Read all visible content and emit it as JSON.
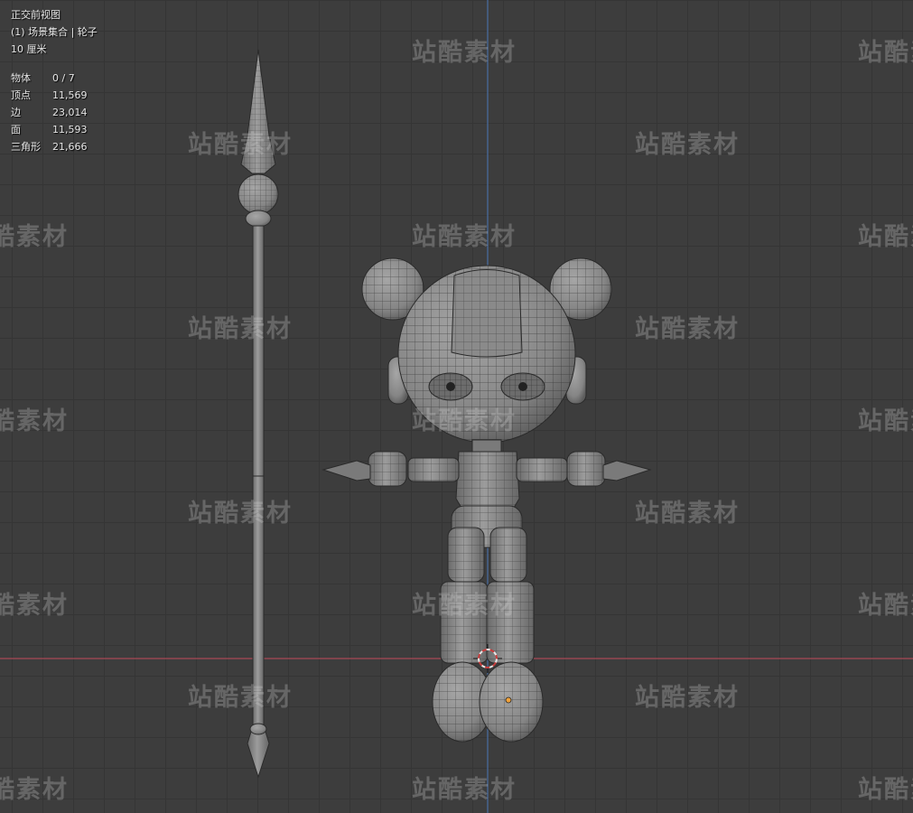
{
  "viewport": {
    "view_name": "正交前视图",
    "collection_line": "(1) 场景集合 | 轮子",
    "grid_scale": "10 厘米"
  },
  "stats": [
    {
      "label": "物体",
      "value": "0 / 7"
    },
    {
      "label": "顶点",
      "value": "11,569"
    },
    {
      "label": "边",
      "value": "23,014"
    },
    {
      "label": "面",
      "value": "11,593"
    },
    {
      "label": "三角形",
      "value": "21,666"
    }
  ],
  "watermark": {
    "text": "站酷素材"
  },
  "colors": {
    "background": "#3d3d3d",
    "grid_line": "#353535",
    "x_axis": "#a84a55",
    "z_axis": "#4a6ea3",
    "mesh_fill": "#8c8c8c",
    "wire": "#2a2a2a",
    "origin_dot": "#f2a23a"
  },
  "icons": {
    "cursor": "3d-cursor-icon",
    "origin": "object-origin-icon"
  }
}
